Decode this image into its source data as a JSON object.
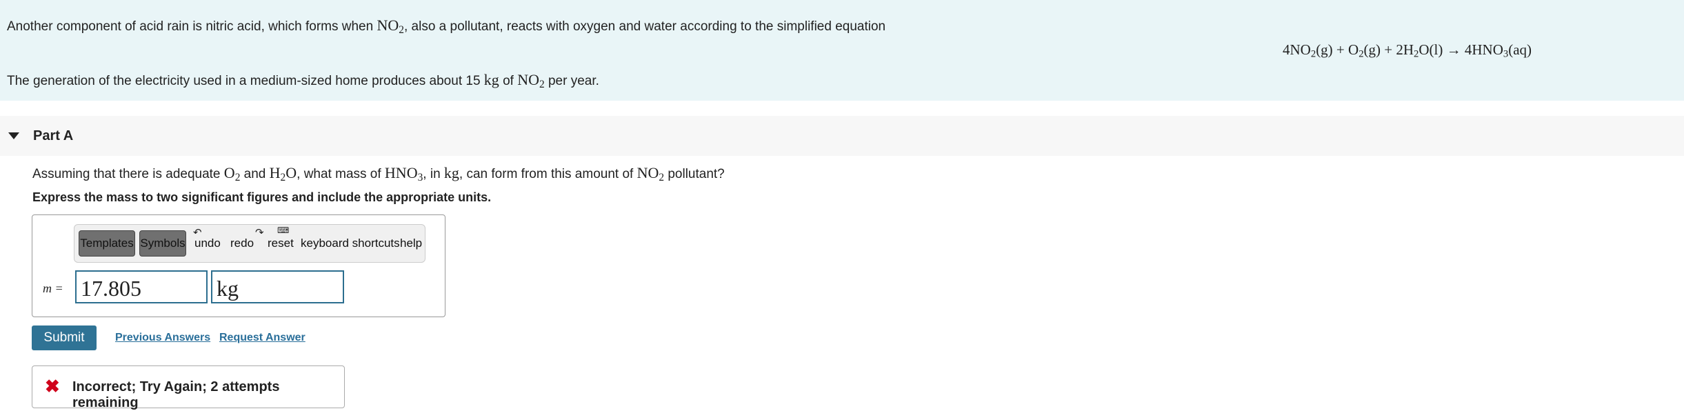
{
  "intro": {
    "line1_pre": "Another component of acid rain is nitric acid, which forms when ",
    "line1_formula": "NO",
    "line1_sub": "2",
    "line1_post": ", also a pollutant, reacts with oxygen and water according to the simplified equation",
    "equation": {
      "p1": "4NO",
      "s1": "2",
      "p2": "(g) + O",
      "s2": "2",
      "p3": "(g) + 2H",
      "s3": "2",
      "p4": "O(l) → 4HNO",
      "s4": "3",
      "p5": "(aq)"
    },
    "line3_pre": "The generation of the electricity used in a medium-sized home produces about 15 ",
    "line3_unit": "kg",
    "line3_mid": " of ",
    "line3_formula": "NO",
    "line3_sub": "2",
    "line3_post": " per year."
  },
  "part": {
    "title": "Part A",
    "question": {
      "a": "Assuming that there is adequate ",
      "f1": "O",
      "s1": "2",
      "b": " and ",
      "f2": "H",
      "s2": "2",
      "f2b": "O",
      "c": ", what mass of ",
      "f3": "HNO",
      "s3": "3",
      "d": ", in ",
      "u": "kg",
      "e": ", can form from this amount of ",
      "f4": "NO",
      "s4": "2",
      "f": " pollutant?"
    },
    "instruction": "Express the mass to two significant figures and include the appropriate units."
  },
  "toolbar": {
    "templates": "Templates",
    "symbols": "Symbols",
    "undo": "undo",
    "redo": "redo",
    "reset": "reset",
    "shortcuts": "keyboard shortcuts",
    "help": "help"
  },
  "answer": {
    "label": "m =",
    "value": "17.805",
    "units": "kg"
  },
  "actions": {
    "submit": "Submit",
    "previous": "Previous Answers",
    "request": "Request Answer"
  },
  "feedback": {
    "icon": "✖",
    "message": "Incorrect; Try Again; 2 attempts remaining"
  },
  "colors": {
    "intro_bg": "#e9f5f7",
    "submit_bg": "#2f7395",
    "link": "#2a6f9a",
    "error": "#d0021b"
  }
}
